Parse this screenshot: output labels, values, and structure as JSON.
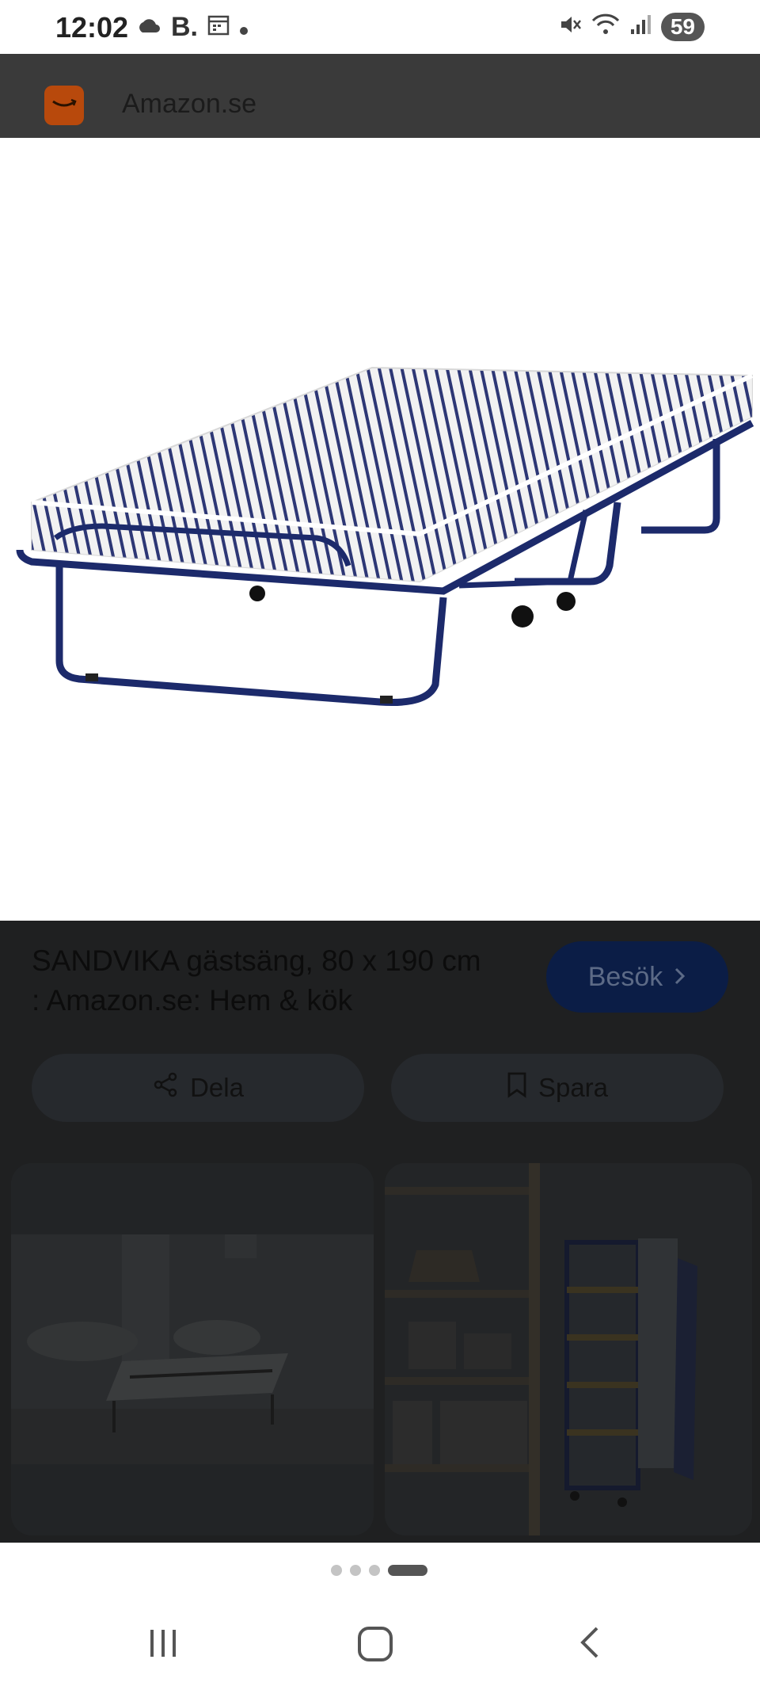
{
  "status_bar": {
    "time": "12:02",
    "carrier_badge": "B.",
    "battery": "59",
    "icons": [
      "cloud-icon",
      "calendar-icon",
      "dot-icon",
      "mute-icon",
      "wifi-icon",
      "signal-icon"
    ]
  },
  "app": {
    "title": "Amazon.se",
    "logo_color": "#b8490c"
  },
  "product": {
    "title": "SANDVIKA gästsäng, 80 x 190 cm : Amazon.se: Hem & kök",
    "visit_label": "Besök",
    "share_label": "Dela",
    "save_label": "Spara"
  },
  "pager": {
    "count": 4,
    "active_index": 3
  },
  "colors": {
    "accent": "#0b1d46",
    "frame": "#1c2a6b"
  }
}
